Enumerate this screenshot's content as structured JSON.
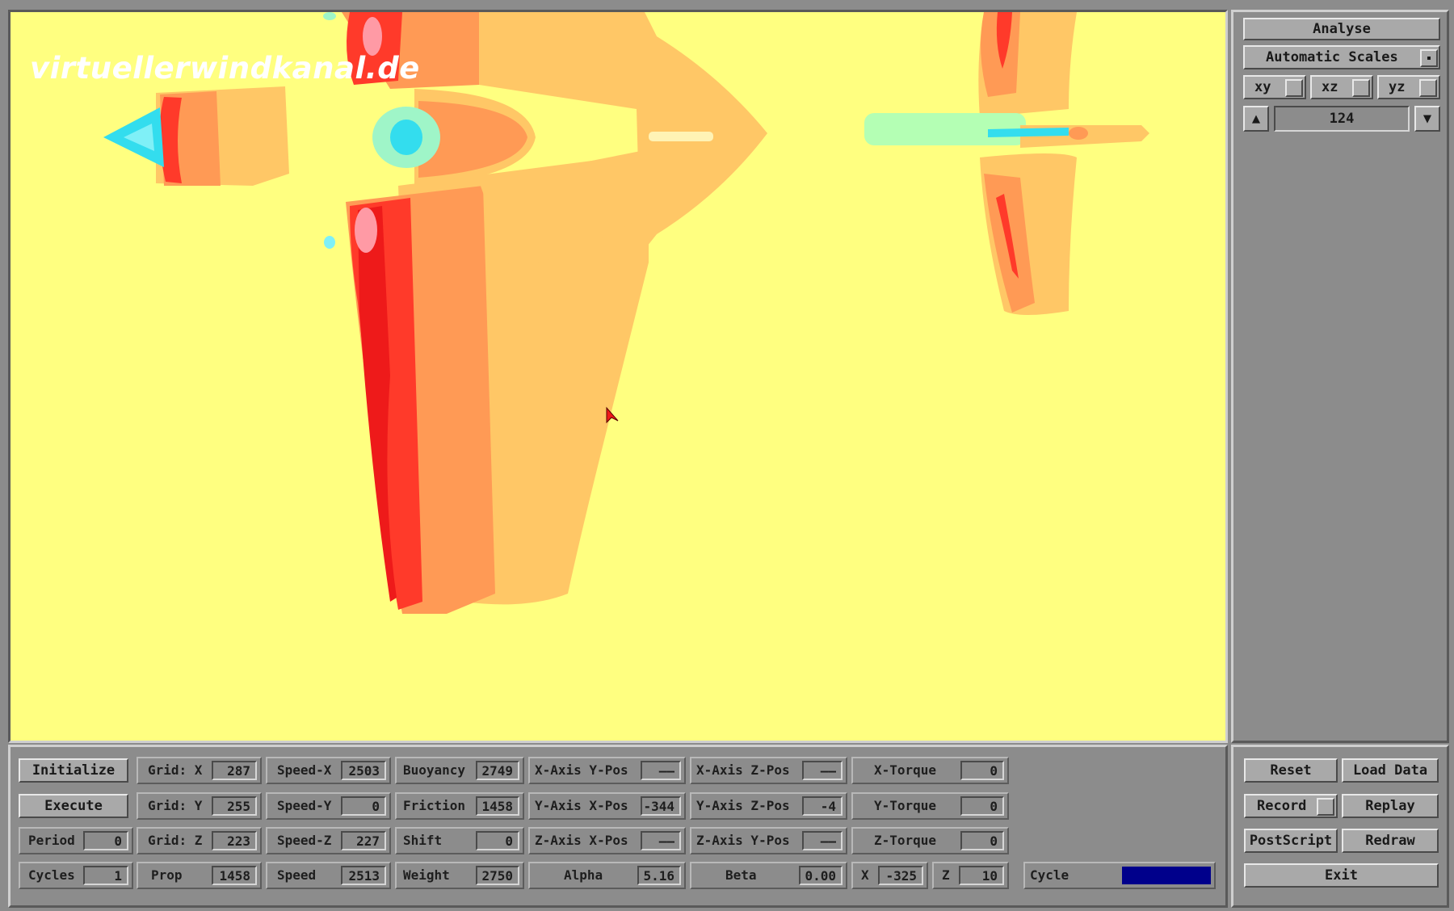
{
  "watermark": "virtuellerwindkanal.de",
  "right_panel": {
    "analyse": "Analyse",
    "automatic_scales": "Automatic Scales",
    "views": [
      {
        "label": "xy"
      },
      {
        "label": "xz"
      },
      {
        "label": "yz"
      }
    ],
    "slice_value": "124",
    "up_arrow": "▲",
    "down_arrow": "▼"
  },
  "bottom": {
    "initialize": "Initialize",
    "execute": "Execute",
    "period_label": "Period",
    "period_value": "0",
    "cycles_label": "Cycles",
    "cycles_value": "1",
    "grid_x_label": "Grid: X",
    "grid_x_value": "287",
    "grid_y_label": "Grid: Y",
    "grid_y_value": "255",
    "grid_z_label": "Grid: Z",
    "grid_z_value": "223",
    "prop_label": "Prop",
    "prop_value": "1458",
    "speed_x_label": "Speed-X",
    "speed_x_value": "2503",
    "speed_y_label": "Speed-Y",
    "speed_y_value": "0",
    "speed_z_label": "Speed-Z",
    "speed_z_value": "227",
    "speed_label": "Speed",
    "speed_value": "2513",
    "buoyancy_label": "Buoyancy",
    "buoyancy_value": "2749",
    "friction_label": "Friction",
    "friction_value": "1458",
    "shift_label": "Shift",
    "shift_value": "0",
    "weight_label": "Weight",
    "weight_value": "2750",
    "x_axis_y_pos_label": "X-Axis Y-Pos",
    "x_axis_y_pos_value": "——",
    "y_axis_x_pos_label": "Y-Axis X-Pos",
    "y_axis_x_pos_value": "-344",
    "z_axis_x_pos_label": "Z-Axis X-Pos",
    "z_axis_x_pos_value": "——",
    "alpha_label": "Alpha",
    "alpha_value": "5.16",
    "x_axis_z_pos_label": "X-Axis Z-Pos",
    "x_axis_z_pos_value": "——",
    "y_axis_z_pos_label": "Y-Axis Z-Pos",
    "y_axis_z_pos_value": "-4",
    "z_axis_y_pos_label": "Z-Axis Y-Pos",
    "z_axis_y_pos_value": "——",
    "beta_label": "Beta",
    "beta_value": "0.00",
    "x_torque_label": "X-Torque",
    "x_torque_value": "0",
    "y_torque_label": "Y-Torque",
    "y_torque_value": "0",
    "z_torque_label": "Z-Torque",
    "z_torque_value": "0",
    "x_label": "X",
    "x_value": "-325",
    "z_label": "Z",
    "z_value": "10",
    "cycle_label": "Cycle",
    "cycle_color": "#00008b"
  },
  "bottom_right": {
    "reset": "Reset",
    "load_data": "Load Data",
    "record": "Record",
    "replay": "Replay",
    "postscript": "PostScript",
    "redraw": "Redraw",
    "exit": "Exit"
  },
  "colors": {
    "background_field": "#ffff80",
    "contour_light_orange": "#ffc766",
    "contour_orange": "#ff9a55",
    "contour_red": "#ff3a2a",
    "contour_cyan": "#33ddee",
    "contour_mint": "#b4ffb4"
  }
}
